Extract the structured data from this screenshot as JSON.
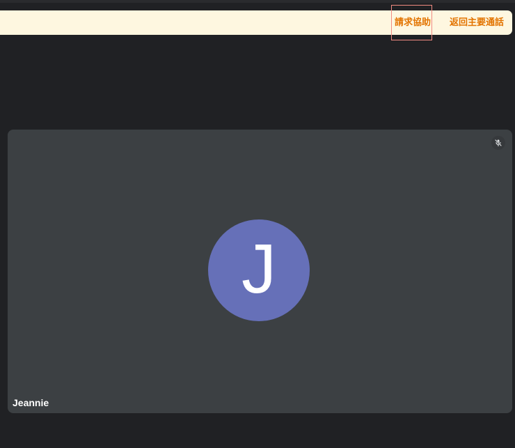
{
  "banner": {
    "request_help_label": "請求協助",
    "return_to_main_call_label": "返回主要通話",
    "text_color": "#e37400",
    "background_color": "#fef7e0"
  },
  "participant_tile": {
    "name": "Jeannie",
    "avatar_initial": "J",
    "avatar_color": "#6670b8",
    "mic_status_icon": "mic-off-icon"
  }
}
